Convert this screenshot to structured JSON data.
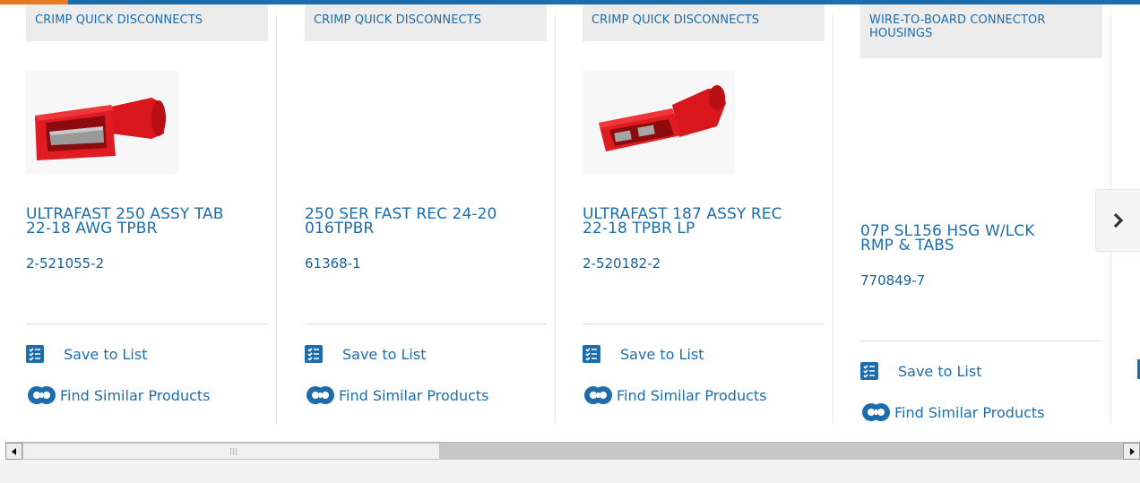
{
  "brand_colors": {
    "primary": "#1a6eab",
    "accent": "#e87722"
  },
  "cards": [
    {
      "tag": "CRIMP QUICK DISCONNECTS",
      "title_line1": "ULTRAFAST 250 ASSY TAB",
      "title_line2": "22-18 AWG TPBR",
      "part_number": "2-521055-2",
      "save_label": "Save to List",
      "similar_label": "Find Similar Products",
      "has_image": true
    },
    {
      "tag": "CRIMP QUICK DISCONNECTS",
      "title_line1": "250 SER FAST REC 24-20",
      "title_line2": "016TPBR",
      "part_number": "61368-1",
      "save_label": "Save to List",
      "similar_label": "Find Similar Products",
      "has_image": false
    },
    {
      "tag": "CRIMP QUICK DISCONNECTS",
      "title_line1": "ULTRAFAST 187 ASSY REC",
      "title_line2": "22-18 TPBR LP",
      "part_number": "2-520182-2",
      "save_label": "Save to List",
      "similar_label": "Find Similar Products",
      "has_image": true
    },
    {
      "tag": "WIRE-TO-BOARD CONNECTOR HOUSINGS",
      "title_line1": "07P SL156 HSG W/LCK",
      "title_line2": "RMP & TABS",
      "part_number": "770849-7",
      "save_label": "Save to List",
      "similar_label": "Find Similar Products",
      "has_image": false
    }
  ],
  "carousel": {
    "next_icon": "chevron-right-icon"
  }
}
